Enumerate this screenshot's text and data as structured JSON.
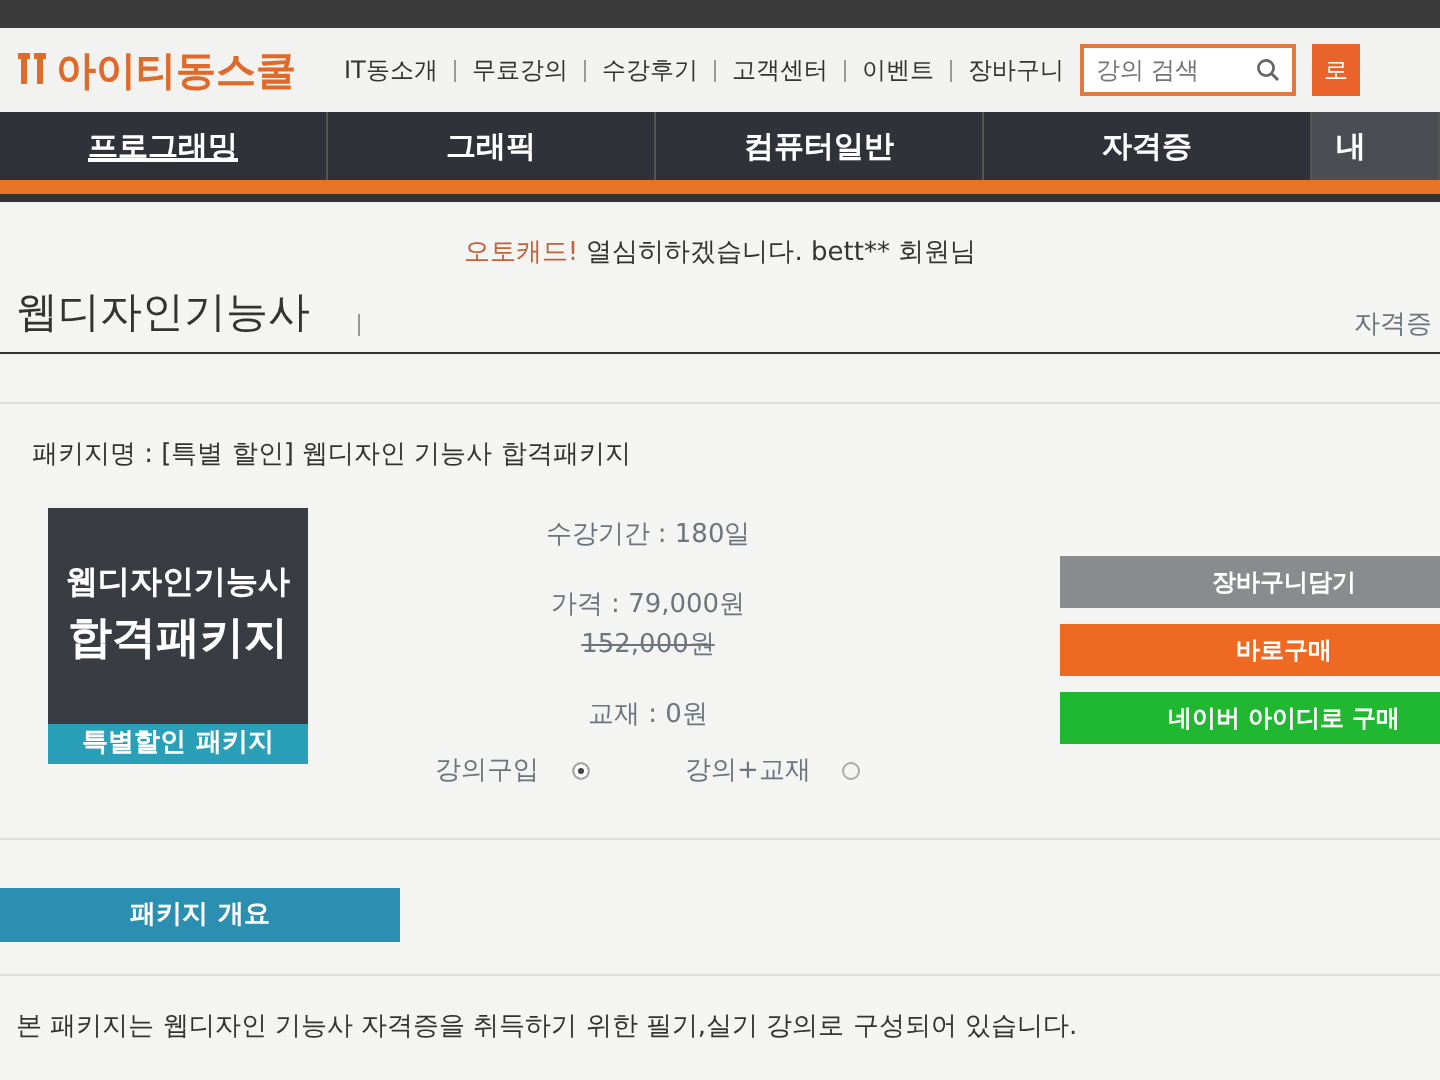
{
  "header": {
    "logo": "아이티동스쿨",
    "links": [
      "IT동소개",
      "무료강의",
      "수강후기",
      "고객센터",
      "이벤트",
      "장바구니"
    ],
    "search": {
      "placeholder": "강의 검색"
    },
    "login_button": "로"
  },
  "nav": [
    {
      "label": "프로그래밍",
      "selected": true
    },
    {
      "label": "그래픽",
      "selected": false
    },
    {
      "label": "컴퓨터일반",
      "selected": false
    },
    {
      "label": "자격증",
      "selected": false
    },
    {
      "label": "내",
      "selected": false
    }
  ],
  "greeting": {
    "brand": "오토캐드!",
    "message": "열심히하겠습니다. bett** 회원님"
  },
  "page_title": "웹디자인기능사",
  "breadcrumb": "자격증",
  "package": {
    "name": "패키지명 : [특별 할인] 웹디자인 기능사 합격패키지",
    "thumbnail": {
      "line1": "웹디자인기능사",
      "line2": "합격패키지",
      "ribbon": "특별할인 패키지"
    },
    "period": "수강기간 : 180일",
    "price": "가격 : 79,000원",
    "original_price": "152,000원",
    "textbook": "교재 : 0원",
    "options": [
      {
        "label": "강의구입",
        "selected": true
      },
      {
        "label": "강의+교재",
        "selected": false
      }
    ],
    "buttons": [
      {
        "label": "장바구니담기",
        "kind": "cart"
      },
      {
        "label": "바로구매",
        "kind": "buy"
      },
      {
        "label": "네이버 아이디로 구매",
        "kind": "naver"
      }
    ]
  },
  "overview": {
    "tab": "패키지 개요",
    "text": "본 패키지는 웹디자인 기능사 자격증을 취득하기 위한 필기,실기 강의로 구성되어 있습니다."
  }
}
